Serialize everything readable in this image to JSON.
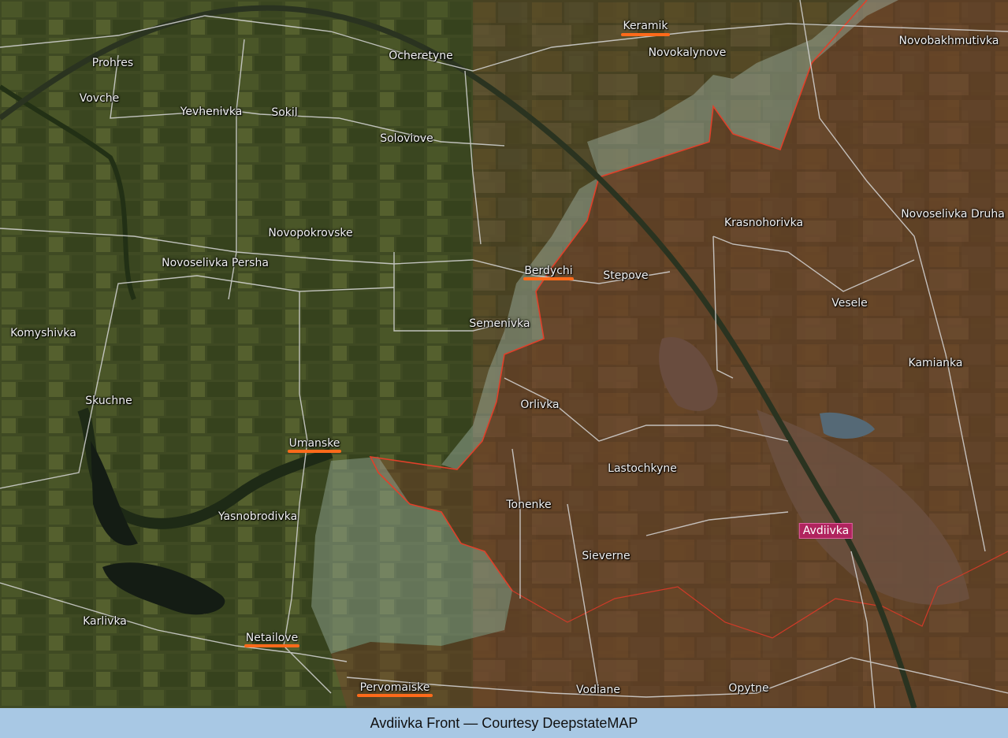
{
  "caption": "Avdiivka Front — Courtesy DeepstateMAP",
  "colors": {
    "occupied_fill": "#8a3a2a",
    "frontline": "#e0402a",
    "gray_zone": "#9fb5a8",
    "highlight_underline": "#ff6a1a",
    "city_badge": "#b0245e"
  },
  "places": {
    "keramik": "Keramik",
    "novobakhmutivka": "Novobakhmutivka",
    "prohres": "Prohres",
    "ocheretyne": "Ocheretyne",
    "novokalynove": "Novokalynove",
    "vovche": "Vovche",
    "yevhenivka": "Yevhenivka",
    "sokil": "Sokil",
    "soloviove": "Soloviove",
    "novoselivka_druha": "Novoselivka Druha",
    "krasnohorivka": "Krasnohorivka",
    "novopokrovske": "Novopokrovske",
    "novoselivka_persha": "Novoselivka Persha",
    "berdychi": "Berdychi",
    "stepove": "Stepove",
    "vesele": "Vesele",
    "semenivka": "Semenivka",
    "komyshivka": "Komyshivka",
    "kamianka": "Kamianka",
    "skuchne": "Skuchne",
    "orlivka": "Orlivka",
    "umanske": "Umanske",
    "lastochkyne": "Lastochkyne",
    "tonenke": "Tonenke",
    "yasnobrodivka": "Yasnobrodivka",
    "avdiivka": "Avdiivka",
    "sieverne": "Sieverne",
    "karlivka": "Karlivka",
    "netailove": "Netailove",
    "pervomaiske": "Pervomaiske",
    "vodiane": "Vodiane",
    "opytne": "Opytne"
  }
}
